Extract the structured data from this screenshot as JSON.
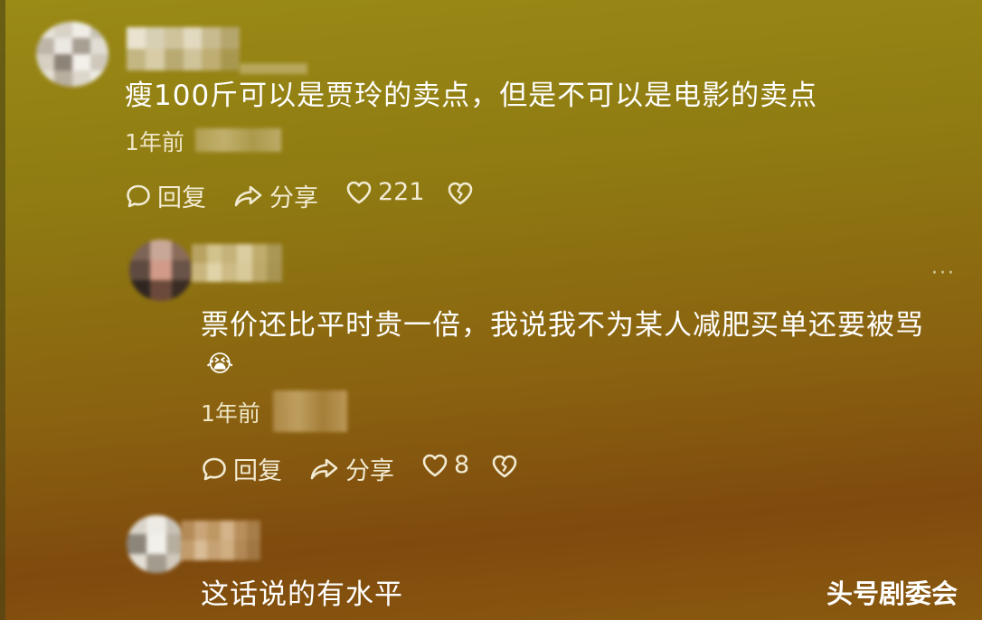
{
  "comments": [
    {
      "text": "瘦100斤可以是贾玲的卖点，但是不可以是电影的卖点",
      "time": "1年前",
      "reply_label": "回复",
      "share_label": "分享",
      "like_count": "221"
    },
    {
      "text_line1": "票价还比平时贵一倍，我说我不为某人减肥买单还要被骂",
      "emoji": "😭",
      "time": "1年前",
      "reply_label": "回复",
      "share_label": "分享",
      "like_count": "8",
      "more": "···"
    },
    {
      "text": "这话说的有水平"
    }
  ],
  "watermark": "头号剧委会",
  "colors": {
    "accent_text": "#ffffff",
    "meta_text": "#eee6c6"
  }
}
